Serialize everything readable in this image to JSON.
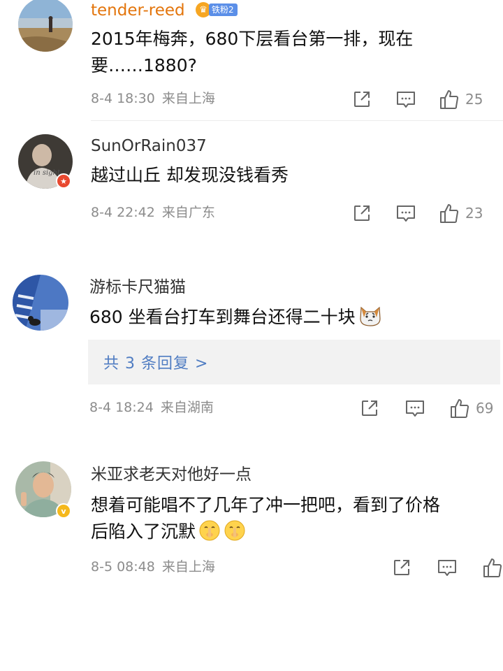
{
  "comments": [
    {
      "username": "tender-reed",
      "fan_badge": "铁粉2",
      "text_lines": [
        "2015年梅奔，680下层看台第一排，现在",
        "要……1880?"
      ],
      "date": "8-4 18:30",
      "location": "来自上海",
      "likes": "25"
    },
    {
      "username": "SunOrRain037",
      "text_lines": [
        "越过山丘 却发现没钱看秀"
      ],
      "date": "8-4 22:42",
      "location": "来自广东",
      "likes": "23"
    },
    {
      "username": "游标卡尺猫猫",
      "text_lines": [
        "680 坐看台打车到舞台还得二十块"
      ],
      "replies_label": "共 3 条回复 >",
      "date": "8-4 18:24",
      "location": "来自湖南",
      "likes": "69"
    },
    {
      "username": "米亚求老天对他好一点",
      "text_lines": [
        "想着可能唱不了几年了冲一把吧，看到了价格",
        "后陷入了沉默"
      ],
      "date": "8-5 08:48",
      "location": "来自上海",
      "likes": ""
    }
  ],
  "icons": {
    "share": "share-icon",
    "comment": "comment-icon",
    "like": "thumbs-up-icon",
    "cat_emoji": "cat-face-emoji",
    "shush_emoji": "shushing-face-emoji"
  },
  "colors": {
    "username": "#e3750c",
    "username_default": "#222222",
    "meta": "#8c8c8c",
    "link": "#4f7cc2",
    "reply_bg": "#f2f2f2",
    "vip_badge": "#f5b81c",
    "star_badge": "#e8482f"
  }
}
